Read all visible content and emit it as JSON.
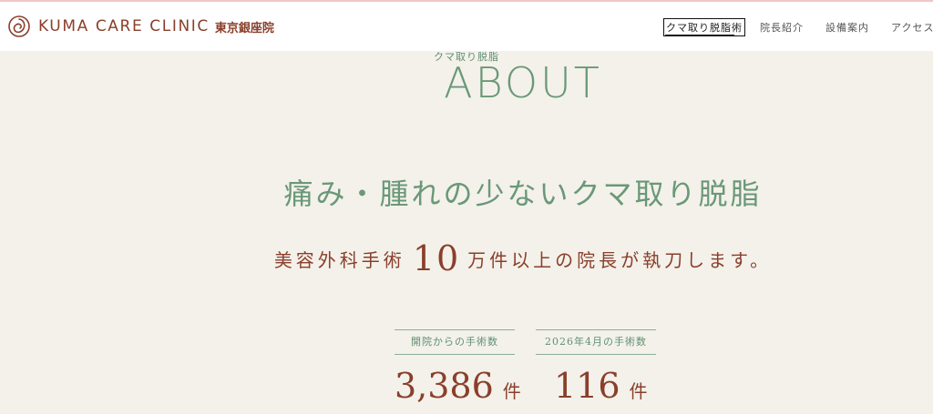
{
  "header": {
    "brand_name": "KUMA CARE CLINIC",
    "brand_sub": "東京銀座院",
    "logo_icon": "swirl-logo-icon"
  },
  "nav": {
    "items": [
      {
        "label": "クマ取り脱脂術",
        "active": true
      },
      {
        "label": "院長紹介",
        "active": false
      },
      {
        "label": "設備案内",
        "active": false
      },
      {
        "label": "アクセス",
        "active": false
      }
    ]
  },
  "about": {
    "label": "クマ取り脱脂",
    "title": "ABOUT",
    "headline": "痛み・腫れの少ないクマ取り脱脂",
    "sub_before": "美容外科手術",
    "sub_number": "10",
    "sub_after": "万件以上の院長が執刀します。"
  },
  "stats": [
    {
      "label": "開院からの手術数",
      "value": "3,386",
      "unit": "件"
    },
    {
      "label": "2026年4月の手術数",
      "value": "116",
      "unit": "件"
    }
  ],
  "colors": {
    "background": "#f3f1ea",
    "brand_brown": "#8a3f2b",
    "accent_green": "#6a9878"
  }
}
